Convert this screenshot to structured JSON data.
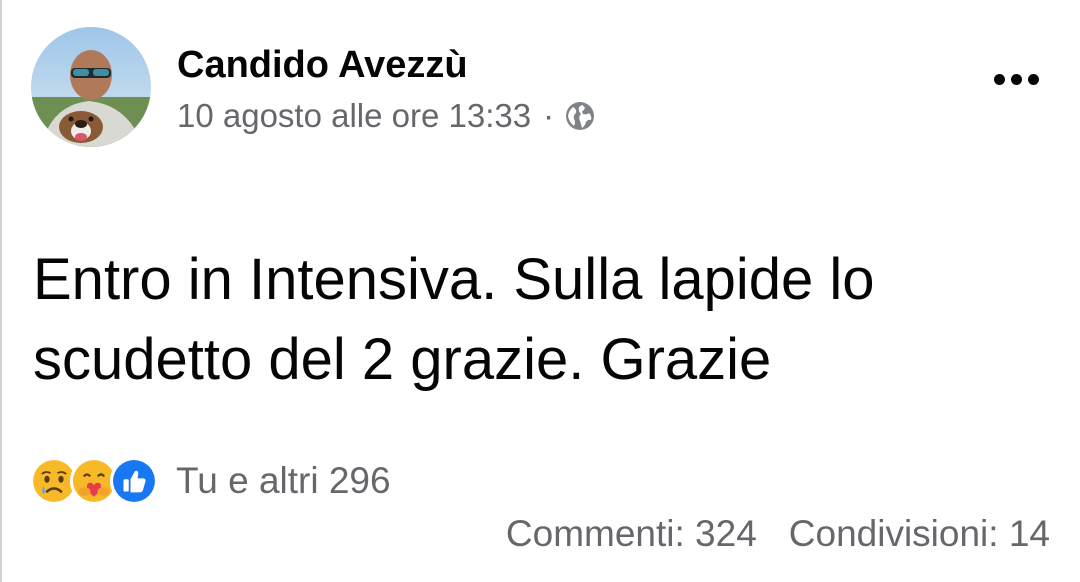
{
  "post": {
    "author": "Candido Avezzù",
    "timestamp": "10 agosto alle ore 13:33",
    "separator": "·",
    "privacy_icon": "globe-icon",
    "more_icon": "more-options-icon",
    "text_lines": [
      "Entro in Intensiva. Sulla lapide lo",
      "scudetto del 2 grazie. Grazie"
    ]
  },
  "reactions": {
    "icons": [
      "sad-reaction-icon",
      "care-reaction-icon",
      "like-reaction-icon"
    ],
    "summary": "Tu e altri 296"
  },
  "stats": {
    "comments": "Commenti: 324",
    "shares": "Condivisioni: 14"
  },
  "colors": {
    "text_primary": "#050505",
    "text_secondary": "#65676b",
    "like_blue": "#1877f2",
    "reaction_yellow": "#f7b928"
  }
}
